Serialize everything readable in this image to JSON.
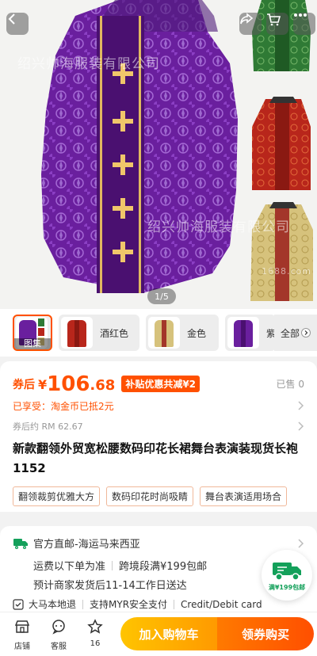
{
  "header": {
    "back_icon": "chevron-left-icon",
    "share_icon": "share-icon",
    "cart_icon": "cart-icon",
    "more_icon": "more-icon"
  },
  "gallery": {
    "counter": "1/5",
    "watermark_top": "绍兴帅海服装有限公司",
    "watermark_bottom": "绍兴帅海服装有限公司",
    "site_mark": "1688.com"
  },
  "thumbnails": [
    {
      "label": "图集",
      "selected": true
    },
    {
      "label": "酒红色",
      "selected": false
    },
    {
      "label": "金色",
      "selected": false
    },
    {
      "label": "紫",
      "selected": false
    }
  ],
  "thumbs_all_label": "全部",
  "price": {
    "prefix": "券后",
    "currency": "¥",
    "integer": "106",
    "decimal": ".68",
    "subsidy_badge": "补贴优惠共减¥2",
    "sold": "已售 0"
  },
  "enjoyed": {
    "label": "已享受：",
    "value": "淘金币已抵2元"
  },
  "original_price": "券后约 RM 62.67",
  "title": "新款翻领外贸宽松腰数码印花长裙舞台表演装现货长袍1152",
  "tags": [
    "翻领裁剪优雅大方",
    "数码印花时尚吸睛",
    "舞台表演适用场合"
  ],
  "shipping": {
    "line1": "官方直邮-海运马来西亚",
    "fee": "运费以下单为准",
    "promo": "跨境段满¥199包邮",
    "dispatch": "预计商家发货后11-14工作日送达"
  },
  "guarantee": {
    "item1": "大马本地退",
    "item2": "支持MYR安全支付",
    "item3": "Credit/Debit card"
  },
  "float_badge": "满¥199包邮",
  "bottom": {
    "shop": "店铺",
    "service": "客服",
    "fav_count": "16",
    "add_cart": "加入购物车",
    "buy": "领券购买"
  },
  "colors": {
    "accent": "#ff5000",
    "cart": "#ffb400",
    "buy": "#ff5a00",
    "ship_green": "#13a05a"
  }
}
